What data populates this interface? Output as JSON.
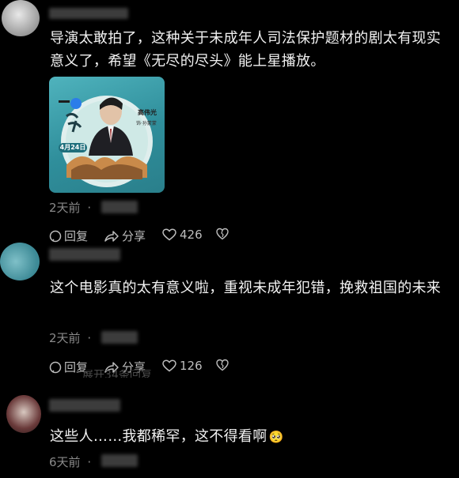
{
  "comments": [
    {
      "text": "导演太敢拍了，这种关于未成年人司法保护题材的剧太有现实意义了，希望《无尽的尽头》能上星播放。",
      "time": "2天前",
      "reply_label": "回复",
      "share_label": "分享",
      "like_count": "426",
      "poster": {
        "date": "4月24日",
        "actor": "高伟光",
        "role": "饰·孙蒙蒙"
      }
    },
    {
      "text": "这个电影真的太有意义啦，重视未成年犯错，挽救祖国的未来",
      "time": "2天前",
      "reply_label": "回复",
      "share_label": "分享",
      "like_count": "126",
      "expand_label": "展开34条回复"
    },
    {
      "text": "这些人……我都稀罕，这不得看啊",
      "time": "6天前",
      "emoji": "🥺"
    }
  ],
  "time_separator": "·",
  "colors": {
    "background": "#000000",
    "text": "#f2f2f2",
    "meta": "#8a8a8a"
  }
}
